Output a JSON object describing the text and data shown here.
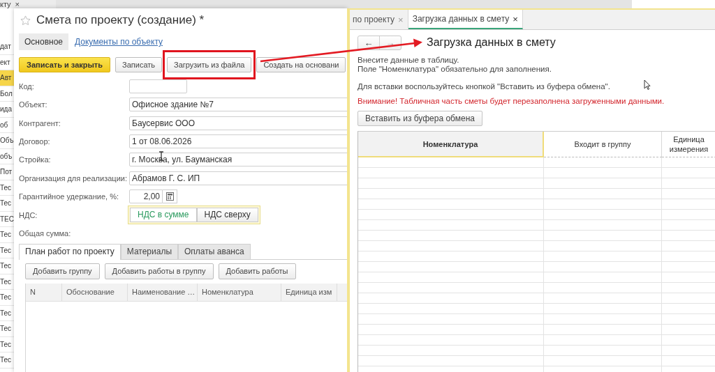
{
  "background": {
    "tab": {
      "label": "кту",
      "close": "×"
    },
    "items": [
      {
        "text": "дат",
        "selected": false
      },
      {
        "text": "ект",
        "selected": false
      },
      {
        "text": "Авт",
        "selected": true
      },
      {
        "text": "Бол",
        "selected": false
      },
      {
        "text": "ида",
        "selected": false
      },
      {
        "text": "об",
        "selected": false
      },
      {
        "text": "Объ",
        "selected": false
      },
      {
        "text": "объ",
        "selected": false
      },
      {
        "text": "Пот",
        "selected": false
      },
      {
        "text": "Тес",
        "selected": false
      },
      {
        "text": "Тес",
        "selected": false
      },
      {
        "text": "ТЕС",
        "selected": false
      },
      {
        "text": "Тес",
        "selected": false
      },
      {
        "text": "Тес",
        "selected": false
      },
      {
        "text": "Тес",
        "selected": false
      },
      {
        "text": "Тес",
        "selected": false
      },
      {
        "text": "Тес",
        "selected": false
      },
      {
        "text": "Тес",
        "selected": false
      },
      {
        "text": "Тес",
        "selected": false
      },
      {
        "text": "Тес",
        "selected": false
      },
      {
        "text": "Тес",
        "selected": false
      }
    ]
  },
  "form": {
    "title": "Смета по проекту (создание) *",
    "sections": [
      {
        "label": "Основное",
        "selected": true
      },
      {
        "label": "Документы по объекту",
        "selected": false
      }
    ],
    "buttons": [
      {
        "label": "Записать и закрыть",
        "kind": "default"
      },
      {
        "label": "Записать",
        "kind": "normal"
      },
      {
        "label": "Загрузить из файла",
        "kind": "highlighted"
      },
      {
        "label": "Создать на основани",
        "kind": "normal"
      }
    ],
    "fields": [
      {
        "label": "Код:",
        "kind": "short"
      },
      {
        "label": "Объект:",
        "kind": "text",
        "value": "Офисное здание №7"
      },
      {
        "label": "Контрагент:",
        "kind": "text",
        "value": "Баусервис ООО"
      },
      {
        "label": "Договор:",
        "kind": "text",
        "value": "1 от 08.06.2026"
      },
      {
        "label": "Стройка:",
        "kind": "text",
        "value": "г. Москва, ул. Бауманская"
      },
      {
        "label": "Организация для реализации:",
        "kind": "text",
        "value": "Абрамов Г. С. ИП"
      },
      {
        "label": "Гарантийное удержание, %:",
        "kind": "number",
        "value": "2,00"
      },
      {
        "label": "НДС:",
        "kind": "toggle",
        "options": [
          {
            "label": "НДС в сумме",
            "selected": true
          },
          {
            "label": "НДС сверху",
            "selected": false
          }
        ]
      },
      {
        "label": "Общая сумма:",
        "kind": "label"
      }
    ],
    "tabs": [
      {
        "label": "План работ по проекту",
        "selected": true
      },
      {
        "label": "Материалы",
        "selected": false
      },
      {
        "label": "Оплаты аванса",
        "selected": false
      }
    ],
    "table_buttons": [
      "Добавить группу",
      "Добавить работы в группу",
      "Добавить работы"
    ],
    "columns": [
      "N",
      "Обоснование",
      "Наименование …",
      "Номенклатура",
      "Единица изм"
    ]
  },
  "loader": {
    "tabs": [
      {
        "label": "по проекту",
        "close": "×",
        "selected": false
      },
      {
        "label": "Загрузка данных в смету",
        "close": "×",
        "selected": true
      }
    ],
    "nav": [
      "←",
      "→"
    ],
    "title": "Загрузка данных в смету",
    "instructions": [
      "Внесите данные в таблицу.",
      "Поле \"Номенклатура\" обязательно для заполнения."
    ],
    "hint": "Для вставки воспользуйтесь кнопкой \"Вставить из буфера обмена\".",
    "warning": "Внимание! Табличная часть сметы будет перезаполнена загруженными данными.",
    "paste_button": "Вставить из буфера обмена",
    "columns": [
      {
        "label": "Номенклатура",
        "selected": true
      },
      {
        "label": "Входит в группу",
        "selected": false
      },
      {
        "label": "Единица измерения",
        "selected": false
      }
    ]
  }
}
